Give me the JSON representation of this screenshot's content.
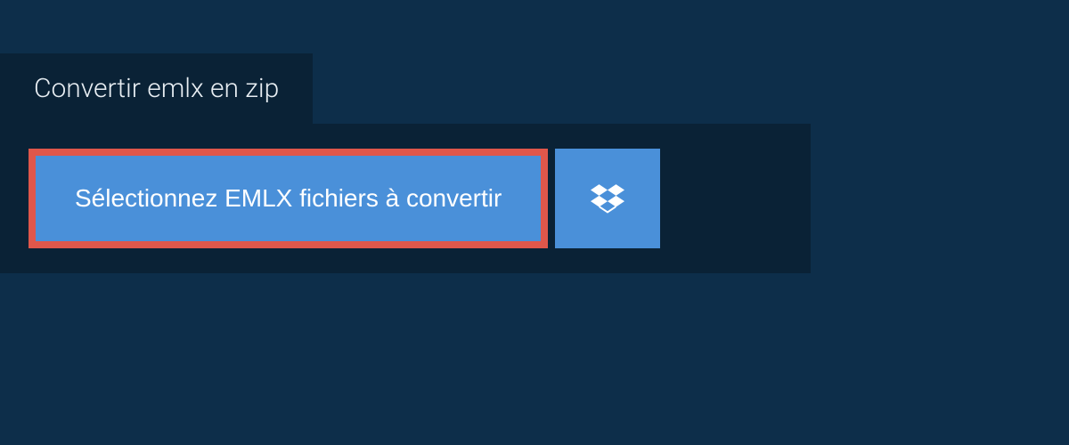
{
  "tab": {
    "label": "Convertir emlx en zip"
  },
  "buttons": {
    "select_files": "Sélectionnez EMLX fichiers à convertir"
  },
  "icons": {
    "dropbox": "dropbox-icon"
  },
  "colors": {
    "background": "#0d2e4a",
    "panel": "#0a2236",
    "button": "#4a90d9",
    "highlight_border": "#e0574b"
  }
}
